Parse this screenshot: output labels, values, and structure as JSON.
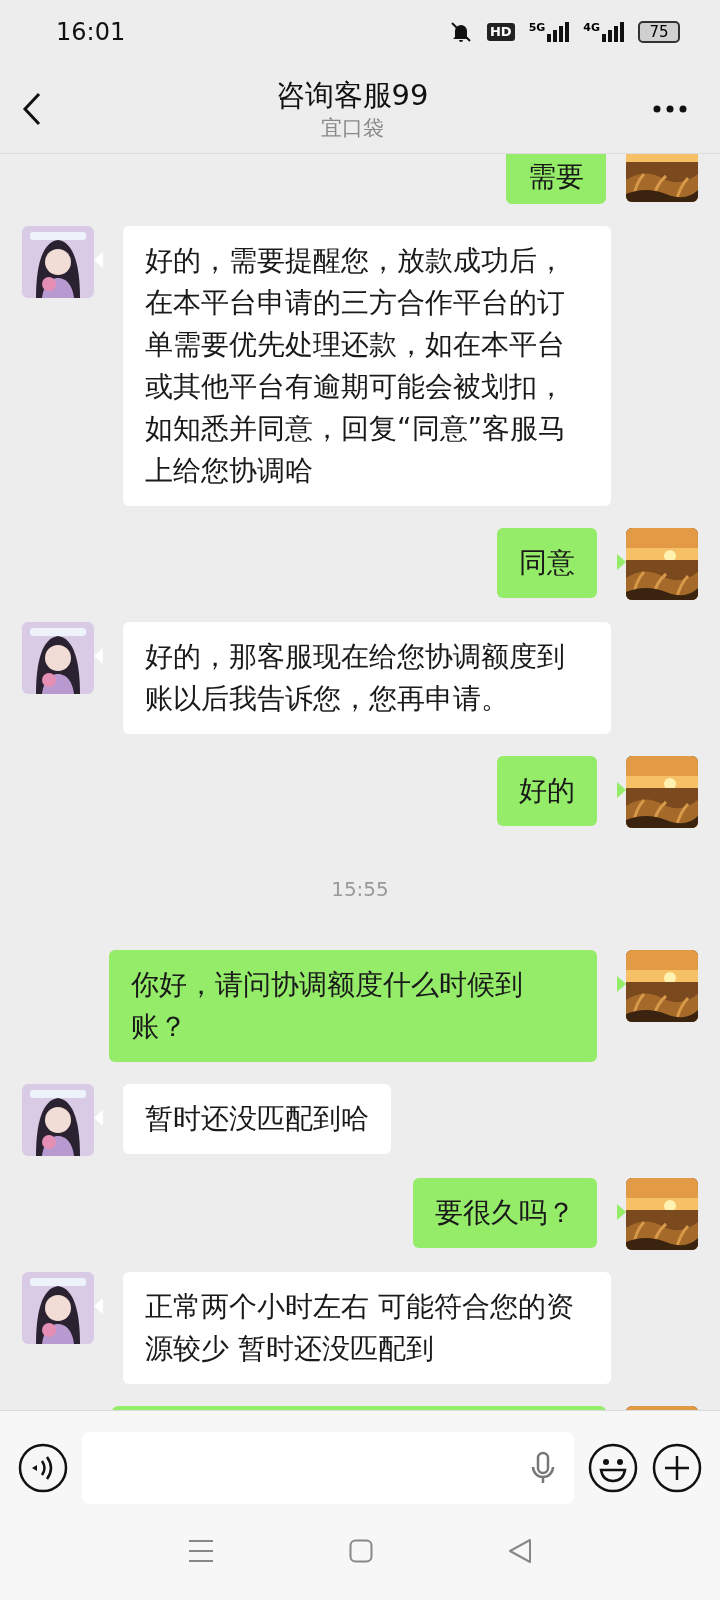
{
  "status_bar": {
    "time": "16:01",
    "hd": "HD",
    "net1": "5G",
    "net2": "4G",
    "battery": "75"
  },
  "header": {
    "title": "咨询客服99",
    "subtitle": "宜口袋"
  },
  "messages": [
    {
      "kind": "sent_cut_top",
      "text": "需要"
    },
    {
      "kind": "received",
      "text": "好的，需要提醒您，放款成功后，在本平台申请的三方合作平台的订单需要优先处理还款，如在本平台或其他平台有逾期可能会被划扣，如知悉并同意，回复“同意”客服马上给您协调哈"
    },
    {
      "kind": "sent",
      "text": "同意"
    },
    {
      "kind": "received",
      "text": "好的，那客服现在给您协调额度到账以后我告诉您，您再申请。"
    },
    {
      "kind": "sent",
      "text": "好的"
    },
    {
      "kind": "time",
      "text": "15:55"
    },
    {
      "kind": "sent",
      "text": "你好，请问协调额度什么时候到账？"
    },
    {
      "kind": "received",
      "text": "暂时还没匹配到哈"
    },
    {
      "kind": "sent",
      "text": "要很久吗？"
    },
    {
      "kind": "received",
      "text": "正常两个小时左右 可能符合您的资源较少  暂时还没匹配到"
    },
    {
      "kind": "sent_cut_bottom"
    }
  ]
}
